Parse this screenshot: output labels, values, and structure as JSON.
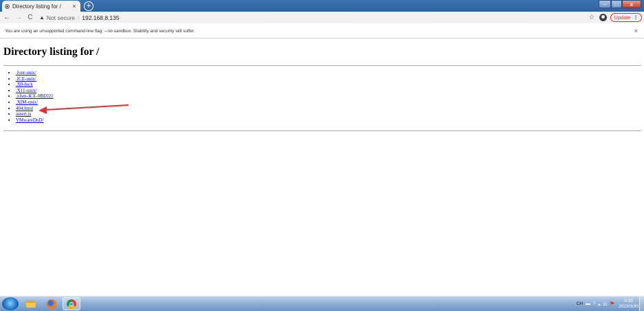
{
  "browser": {
    "tab_title": "Directory listing for /",
    "tab_close": "×",
    "new_tab": "+",
    "window_controls": {
      "minimize": "–",
      "maximize": "□",
      "close": "x"
    },
    "nav": {
      "back": "←",
      "forward": "→",
      "reload": "C"
    },
    "security_label": "Not secure",
    "url": "192.168.8.135",
    "update_label": "Update",
    "menu_icon": "⋮"
  },
  "infobar": {
    "message": "You are using an unsupported command-line flag: --no-sandbox. Stability and security will suffer.",
    "close": "×"
  },
  "page": {
    "heading": "Directory listing for /",
    "entries": [
      ".font-unix/",
      ".ICE-unix/",
      ".X0-lock",
      ".X11-unix/",
      ".xfsm-ICE-0BE021",
      ".XIM-unix/",
      "404.html",
      "assert.js",
      "VMwareDnD/"
    ],
    "annotation": {
      "target_entry": "404.html",
      "color": "#e03030"
    }
  },
  "taskbar": {
    "apps": [
      "start-orb",
      "windows-explorer",
      "firefox",
      "chrome"
    ],
    "tray": {
      "ime": "CH",
      "time": "0:35",
      "date": "2023/3/30"
    }
  },
  "colors": {
    "titlebar": "#3568a8",
    "link": "#0000ee",
    "update": "#d93025",
    "arrow": "#e03030"
  }
}
